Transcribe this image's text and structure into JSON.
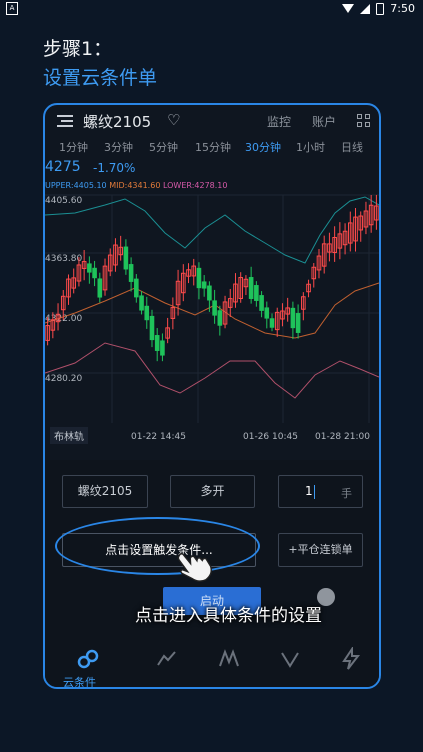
{
  "status_bar": {
    "time": "7:50",
    "left_badge": "A"
  },
  "step": {
    "line1": "步骤1：",
    "line2": "设置云条件单"
  },
  "topbar": {
    "title": "螺纹2105",
    "monitor": "监控",
    "account": "账户"
  },
  "timeframes": [
    {
      "label": "1分钟",
      "active": false
    },
    {
      "label": "3分钟",
      "active": false
    },
    {
      "label": "5分钟",
      "active": false
    },
    {
      "label": "15分钟",
      "active": false
    },
    {
      "label": "30分钟",
      "active": true
    },
    {
      "label": "1小时",
      "active": false
    },
    {
      "label": "日线",
      "active": false
    }
  ],
  "quote": {
    "last_price": "4275",
    "change_pct": "-1.70%"
  },
  "boll": {
    "upper": "UPPER:4405.10",
    "mid": "MID:4341.60",
    "lower": "LOWER:4278.10",
    "upper_color": "#3e9bf2",
    "mid_color": "#e07a3a",
    "lower_color": "#d65aa8"
  },
  "chart": {
    "y_labels": [
      "4405.60",
      "4363.80",
      "4322.00",
      "4280.20"
    ],
    "x_labels": [
      "01-22 14:45",
      "01-26 10:45",
      "01-28 21:00"
    ],
    "indicator": "布林轨",
    "up_color": "#ff4b4b",
    "down_color": "#1fc35b"
  },
  "order_form": {
    "contract": "螺纹2105",
    "direction": "多开",
    "quantity": "1",
    "unit": "手",
    "trigger_button": "点击设置触发条件...",
    "lock_button": "+平仓连锁单",
    "start_button": "启动"
  },
  "tabbar": {
    "first_tab": "云条件单"
  },
  "annotation": {
    "callout": "点击进入具体条件的设置"
  },
  "colors": {
    "accent": "#2a86e6"
  }
}
